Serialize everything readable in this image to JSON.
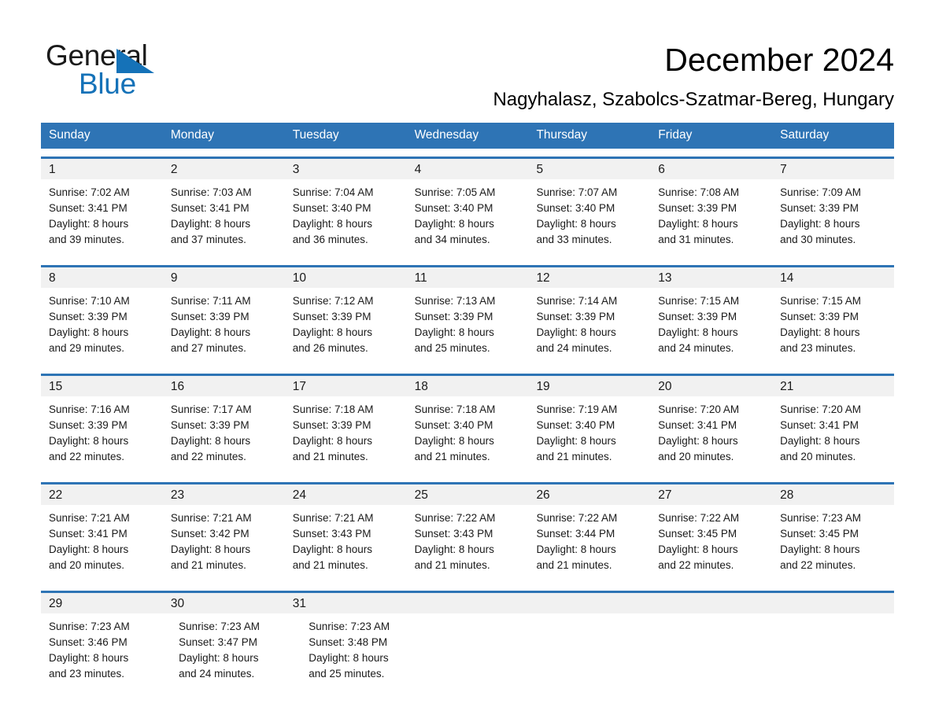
{
  "brand": {
    "name_part1": "General",
    "name_part2": "Blue",
    "accent_color": "#1572b8"
  },
  "header": {
    "title": "December 2024",
    "subtitle": "Nagyhalasz, Szabolcs-Szatmar-Bereg, Hungary"
  },
  "colors": {
    "header_blue": "#2e74b5",
    "daynum_band": "#f1f1f1",
    "text": "#1a1a1a"
  },
  "weekdays": [
    "Sunday",
    "Monday",
    "Tuesday",
    "Wednesday",
    "Thursday",
    "Friday",
    "Saturday"
  ],
  "weeks": [
    {
      "days": [
        {
          "num": "1",
          "sunrise": "Sunrise: 7:02 AM",
          "sunset": "Sunset: 3:41 PM",
          "daylight1": "Daylight: 8 hours",
          "daylight2": "and 39 minutes."
        },
        {
          "num": "2",
          "sunrise": "Sunrise: 7:03 AM",
          "sunset": "Sunset: 3:41 PM",
          "daylight1": "Daylight: 8 hours",
          "daylight2": "and 37 minutes."
        },
        {
          "num": "3",
          "sunrise": "Sunrise: 7:04 AM",
          "sunset": "Sunset: 3:40 PM",
          "daylight1": "Daylight: 8 hours",
          "daylight2": "and 36 minutes."
        },
        {
          "num": "4",
          "sunrise": "Sunrise: 7:05 AM",
          "sunset": "Sunset: 3:40 PM",
          "daylight1": "Daylight: 8 hours",
          "daylight2": "and 34 minutes."
        },
        {
          "num": "5",
          "sunrise": "Sunrise: 7:07 AM",
          "sunset": "Sunset: 3:40 PM",
          "daylight1": "Daylight: 8 hours",
          "daylight2": "and 33 minutes."
        },
        {
          "num": "6",
          "sunrise": "Sunrise: 7:08 AM",
          "sunset": "Sunset: 3:39 PM",
          "daylight1": "Daylight: 8 hours",
          "daylight2": "and 31 minutes."
        },
        {
          "num": "7",
          "sunrise": "Sunrise: 7:09 AM",
          "sunset": "Sunset: 3:39 PM",
          "daylight1": "Daylight: 8 hours",
          "daylight2": "and 30 minutes."
        }
      ]
    },
    {
      "days": [
        {
          "num": "8",
          "sunrise": "Sunrise: 7:10 AM",
          "sunset": "Sunset: 3:39 PM",
          "daylight1": "Daylight: 8 hours",
          "daylight2": "and 29 minutes."
        },
        {
          "num": "9",
          "sunrise": "Sunrise: 7:11 AM",
          "sunset": "Sunset: 3:39 PM",
          "daylight1": "Daylight: 8 hours",
          "daylight2": "and 27 minutes."
        },
        {
          "num": "10",
          "sunrise": "Sunrise: 7:12 AM",
          "sunset": "Sunset: 3:39 PM",
          "daylight1": "Daylight: 8 hours",
          "daylight2": "and 26 minutes."
        },
        {
          "num": "11",
          "sunrise": "Sunrise: 7:13 AM",
          "sunset": "Sunset: 3:39 PM",
          "daylight1": "Daylight: 8 hours",
          "daylight2": "and 25 minutes."
        },
        {
          "num": "12",
          "sunrise": "Sunrise: 7:14 AM",
          "sunset": "Sunset: 3:39 PM",
          "daylight1": "Daylight: 8 hours",
          "daylight2": "and 24 minutes."
        },
        {
          "num": "13",
          "sunrise": "Sunrise: 7:15 AM",
          "sunset": "Sunset: 3:39 PM",
          "daylight1": "Daylight: 8 hours",
          "daylight2": "and 24 minutes."
        },
        {
          "num": "14",
          "sunrise": "Sunrise: 7:15 AM",
          "sunset": "Sunset: 3:39 PM",
          "daylight1": "Daylight: 8 hours",
          "daylight2": "and 23 minutes."
        }
      ]
    },
    {
      "days": [
        {
          "num": "15",
          "sunrise": "Sunrise: 7:16 AM",
          "sunset": "Sunset: 3:39 PM",
          "daylight1": "Daylight: 8 hours",
          "daylight2": "and 22 minutes."
        },
        {
          "num": "16",
          "sunrise": "Sunrise: 7:17 AM",
          "sunset": "Sunset: 3:39 PM",
          "daylight1": "Daylight: 8 hours",
          "daylight2": "and 22 minutes."
        },
        {
          "num": "17",
          "sunrise": "Sunrise: 7:18 AM",
          "sunset": "Sunset: 3:39 PM",
          "daylight1": "Daylight: 8 hours",
          "daylight2": "and 21 minutes."
        },
        {
          "num": "18",
          "sunrise": "Sunrise: 7:18 AM",
          "sunset": "Sunset: 3:40 PM",
          "daylight1": "Daylight: 8 hours",
          "daylight2": "and 21 minutes."
        },
        {
          "num": "19",
          "sunrise": "Sunrise: 7:19 AM",
          "sunset": "Sunset: 3:40 PM",
          "daylight1": "Daylight: 8 hours",
          "daylight2": "and 21 minutes."
        },
        {
          "num": "20",
          "sunrise": "Sunrise: 7:20 AM",
          "sunset": "Sunset: 3:41 PM",
          "daylight1": "Daylight: 8 hours",
          "daylight2": "and 20 minutes."
        },
        {
          "num": "21",
          "sunrise": "Sunrise: 7:20 AM",
          "sunset": "Sunset: 3:41 PM",
          "daylight1": "Daylight: 8 hours",
          "daylight2": "and 20 minutes."
        }
      ]
    },
    {
      "days": [
        {
          "num": "22",
          "sunrise": "Sunrise: 7:21 AM",
          "sunset": "Sunset: 3:41 PM",
          "daylight1": "Daylight: 8 hours",
          "daylight2": "and 20 minutes."
        },
        {
          "num": "23",
          "sunrise": "Sunrise: 7:21 AM",
          "sunset": "Sunset: 3:42 PM",
          "daylight1": "Daylight: 8 hours",
          "daylight2": "and 21 minutes."
        },
        {
          "num": "24",
          "sunrise": "Sunrise: 7:21 AM",
          "sunset": "Sunset: 3:43 PM",
          "daylight1": "Daylight: 8 hours",
          "daylight2": "and 21 minutes."
        },
        {
          "num": "25",
          "sunrise": "Sunrise: 7:22 AM",
          "sunset": "Sunset: 3:43 PM",
          "daylight1": "Daylight: 8 hours",
          "daylight2": "and 21 minutes."
        },
        {
          "num": "26",
          "sunrise": "Sunrise: 7:22 AM",
          "sunset": "Sunset: 3:44 PM",
          "daylight1": "Daylight: 8 hours",
          "daylight2": "and 21 minutes."
        },
        {
          "num": "27",
          "sunrise": "Sunrise: 7:22 AM",
          "sunset": "Sunset: 3:45 PM",
          "daylight1": "Daylight: 8 hours",
          "daylight2": "and 22 minutes."
        },
        {
          "num": "28",
          "sunrise": "Sunrise: 7:23 AM",
          "sunset": "Sunset: 3:45 PM",
          "daylight1": "Daylight: 8 hours",
          "daylight2": "and 22 minutes."
        }
      ]
    },
    {
      "days": [
        {
          "num": "29",
          "sunrise": "Sunrise: 7:23 AM",
          "sunset": "Sunset: 3:46 PM",
          "daylight1": "Daylight: 8 hours",
          "daylight2": "and 23 minutes."
        },
        {
          "num": "30",
          "sunrise": "Sunrise: 7:23 AM",
          "sunset": "Sunset: 3:47 PM",
          "daylight1": "Daylight: 8 hours",
          "daylight2": "and 24 minutes."
        },
        {
          "num": "31",
          "sunrise": "Sunrise: 7:23 AM",
          "sunset": "Sunset: 3:48 PM",
          "daylight1": "Daylight: 8 hours",
          "daylight2": "and 25 minutes."
        },
        {
          "num": "",
          "sunrise": "",
          "sunset": "",
          "daylight1": "",
          "daylight2": ""
        },
        {
          "num": "",
          "sunrise": "",
          "sunset": "",
          "daylight1": "",
          "daylight2": ""
        },
        {
          "num": "",
          "sunrise": "",
          "sunset": "",
          "daylight1": "",
          "daylight2": ""
        },
        {
          "num": "",
          "sunrise": "",
          "sunset": "",
          "daylight1": "",
          "daylight2": ""
        }
      ]
    }
  ]
}
